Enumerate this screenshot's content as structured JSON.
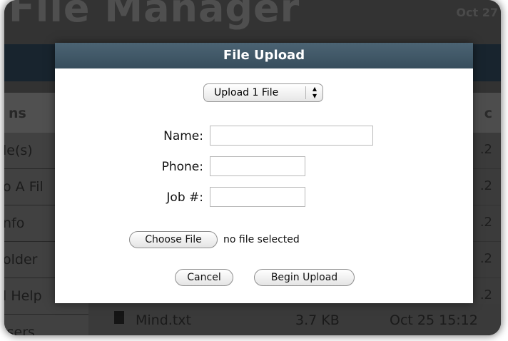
{
  "app": {
    "title": "File Manager",
    "date": "Oct 27"
  },
  "sidebar": {
    "header": "ns",
    "items": [
      {
        "label": "le(s)"
      },
      {
        "label": "o A Fil"
      },
      {
        "label": "nfo"
      },
      {
        "label": "older"
      },
      {
        "label": "l Help"
      },
      {
        "label": "Jsers"
      }
    ]
  },
  "main": {
    "header": "c",
    "row_times": [
      ".2",
      ".2",
      ".2",
      ".2",
      ".2",
      ".2"
    ],
    "file": {
      "icon": "document-icon",
      "name": "Mind.txt",
      "size": "3.7 KB",
      "date": "Oct 25 15:12"
    }
  },
  "dialog": {
    "title": "File Upload",
    "upload_select": {
      "selected": "Upload 1 File",
      "arrows": "▲▼"
    },
    "fields": {
      "name_label": "Name:",
      "phone_label": "Phone:",
      "job_label": "Job #:",
      "name_value": "",
      "phone_value": "",
      "job_value": ""
    },
    "choose_file_label": "Choose File",
    "no_file_text": "no file selected",
    "cancel_label": "Cancel",
    "begin_label": "Begin Upload"
  }
}
